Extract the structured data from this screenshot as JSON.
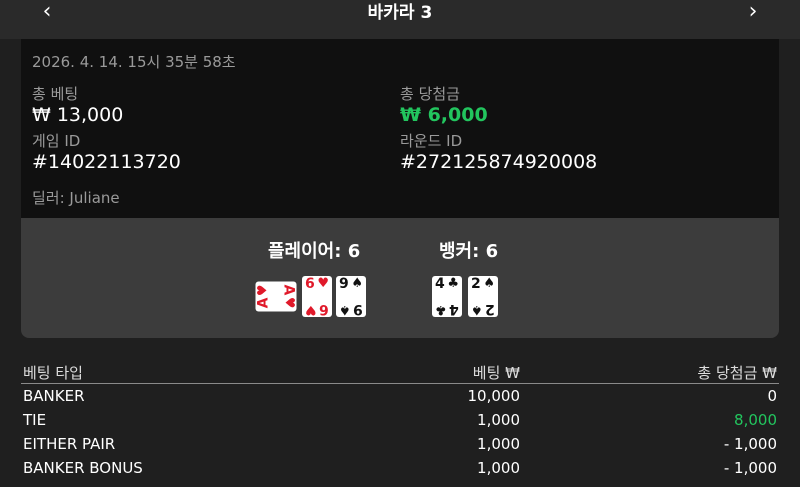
{
  "header": {
    "title": "바카라 3",
    "back_icon": "‹",
    "forward_icon": "›"
  },
  "info": {
    "datetime": "2026. 4. 14. 15시 35분 58초",
    "total_bet_label": "총 베팅",
    "total_bet_value": "₩ 13,000",
    "total_win_label": "총 당첨금",
    "total_win_value": "₩ 6,000",
    "game_id_label": "게임 ID",
    "game_id_value": "#14022113720",
    "round_id_label": "라운드 ID",
    "round_id_value": "#272125874920008",
    "dealer": "딜러: Juliane"
  },
  "result": {
    "player_label": "플레이어: 6",
    "banker_label": "뱅커: 6",
    "player_cards": [
      {
        "rank": "A",
        "suit": "♥",
        "color": "#e0192a",
        "rotated": true
      },
      {
        "rank": "6",
        "suit": "♥",
        "color": "#e0192a",
        "rotated": false
      },
      {
        "rank": "9",
        "suit": "♠",
        "color": "#111111",
        "rotated": false
      }
    ],
    "banker_cards": [
      {
        "rank": "4",
        "suit": "♣",
        "color": "#111111",
        "rotated": false
      },
      {
        "rank": "2",
        "suit": "♠",
        "color": "#111111",
        "rotated": false
      }
    ]
  },
  "bets_table": {
    "headers": [
      "베팅 타입",
      "베팅 ₩",
      "총 당첨금 ₩"
    ],
    "rows": [
      {
        "type": "BANKER",
        "bet": "10,000",
        "win": "0",
        "win_color": "#ffffff"
      },
      {
        "type": "TIE",
        "bet": "1,000",
        "win": "8,000",
        "win_color": "#22c55e"
      },
      {
        "type": "EITHER PAIR",
        "bet": "1,000",
        "win": "- 1,000",
        "win_color": "#ffffff"
      },
      {
        "type": "BANKER BONUS",
        "bet": "1,000",
        "win": "- 1,000",
        "win_color": "#ffffff"
      }
    ]
  },
  "colors": {
    "accent_green": "#22c55e",
    "card_red": "#e0192a",
    "panel_bg": "#3c3c3c",
    "info_bg": "#101010"
  }
}
